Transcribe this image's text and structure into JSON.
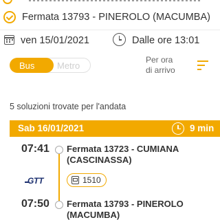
{
  "route": {
    "from_stop": "Fermata 13793 - PINEROLO (MACUMBA)"
  },
  "when": {
    "date": "ven 15/01/2021",
    "time": "Dalle ore 13:01"
  },
  "modes": {
    "bus_label": "Bus",
    "metro_label": "Metro",
    "selected": "Bus"
  },
  "order": {
    "label_line1": "Per ora",
    "label_line2": "di arrivo"
  },
  "results": {
    "summary": "5 soluzioni trovate per l'andata"
  },
  "solution": {
    "day": "Sab 16/01/2021",
    "duration": "9 min",
    "departure_time": "07:41",
    "departure_stop": "Fermata 13723 - CUMIANA (CASCINASSA)",
    "operator": "GTT",
    "line_number": "1510",
    "arrival_time": "07:50",
    "arrival_stop": "Fermata 13793 - PINEROLO (MACUMBA)"
  },
  "colors": {
    "accent": "#f2a900",
    "operator": "#1a2e6e"
  },
  "icons": [
    "bus-stop-icon",
    "calendar-icon",
    "clock-icon",
    "sort-icon",
    "duration-clock-icon",
    "bus-icon"
  ]
}
